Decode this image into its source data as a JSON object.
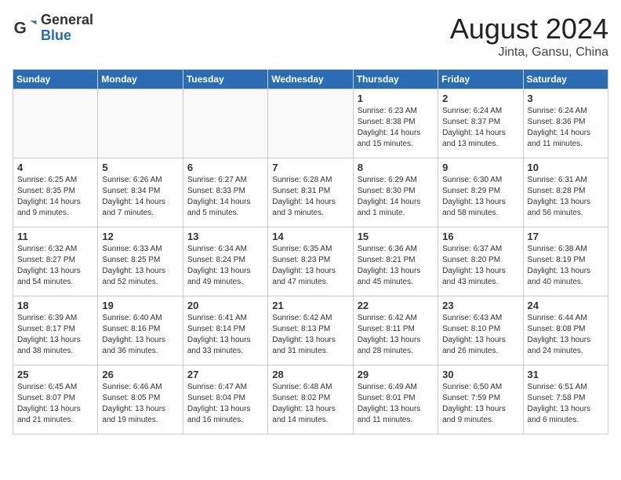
{
  "header": {
    "logo_general": "General",
    "logo_blue": "Blue",
    "month_title": "August 2024",
    "location": "Jinta, Gansu, China"
  },
  "weekdays": [
    "Sunday",
    "Monday",
    "Tuesday",
    "Wednesday",
    "Thursday",
    "Friday",
    "Saturday"
  ],
  "weeks": [
    [
      {
        "day": "",
        "info": ""
      },
      {
        "day": "",
        "info": ""
      },
      {
        "day": "",
        "info": ""
      },
      {
        "day": "",
        "info": ""
      },
      {
        "day": "1",
        "info": "Sunrise: 6:23 AM\nSunset: 8:38 PM\nDaylight: 14 hours\nand 15 minutes."
      },
      {
        "day": "2",
        "info": "Sunrise: 6:24 AM\nSunset: 8:37 PM\nDaylight: 14 hours\nand 13 minutes."
      },
      {
        "day": "3",
        "info": "Sunrise: 6:24 AM\nSunset: 8:36 PM\nDaylight: 14 hours\nand 11 minutes."
      }
    ],
    [
      {
        "day": "4",
        "info": "Sunrise: 6:25 AM\nSunset: 8:35 PM\nDaylight: 14 hours\nand 9 minutes."
      },
      {
        "day": "5",
        "info": "Sunrise: 6:26 AM\nSunset: 8:34 PM\nDaylight: 14 hours\nand 7 minutes."
      },
      {
        "day": "6",
        "info": "Sunrise: 6:27 AM\nSunset: 8:33 PM\nDaylight: 14 hours\nand 5 minutes."
      },
      {
        "day": "7",
        "info": "Sunrise: 6:28 AM\nSunset: 8:31 PM\nDaylight: 14 hours\nand 3 minutes."
      },
      {
        "day": "8",
        "info": "Sunrise: 6:29 AM\nSunset: 8:30 PM\nDaylight: 14 hours\nand 1 minute."
      },
      {
        "day": "9",
        "info": "Sunrise: 6:30 AM\nSunset: 8:29 PM\nDaylight: 13 hours\nand 58 minutes."
      },
      {
        "day": "10",
        "info": "Sunrise: 6:31 AM\nSunset: 8:28 PM\nDaylight: 13 hours\nand 56 minutes."
      }
    ],
    [
      {
        "day": "11",
        "info": "Sunrise: 6:32 AM\nSunset: 8:27 PM\nDaylight: 13 hours\nand 54 minutes."
      },
      {
        "day": "12",
        "info": "Sunrise: 6:33 AM\nSunset: 8:25 PM\nDaylight: 13 hours\nand 52 minutes."
      },
      {
        "day": "13",
        "info": "Sunrise: 6:34 AM\nSunset: 8:24 PM\nDaylight: 13 hours\nand 49 minutes."
      },
      {
        "day": "14",
        "info": "Sunrise: 6:35 AM\nSunset: 8:23 PM\nDaylight: 13 hours\nand 47 minutes."
      },
      {
        "day": "15",
        "info": "Sunrise: 6:36 AM\nSunset: 8:21 PM\nDaylight: 13 hours\nand 45 minutes."
      },
      {
        "day": "16",
        "info": "Sunrise: 6:37 AM\nSunset: 8:20 PM\nDaylight: 13 hours\nand 43 minutes."
      },
      {
        "day": "17",
        "info": "Sunrise: 6:38 AM\nSunset: 8:19 PM\nDaylight: 13 hours\nand 40 minutes."
      }
    ],
    [
      {
        "day": "18",
        "info": "Sunrise: 6:39 AM\nSunset: 8:17 PM\nDaylight: 13 hours\nand 38 minutes."
      },
      {
        "day": "19",
        "info": "Sunrise: 6:40 AM\nSunset: 8:16 PM\nDaylight: 13 hours\nand 36 minutes."
      },
      {
        "day": "20",
        "info": "Sunrise: 6:41 AM\nSunset: 8:14 PM\nDaylight: 13 hours\nand 33 minutes."
      },
      {
        "day": "21",
        "info": "Sunrise: 6:42 AM\nSunset: 8:13 PM\nDaylight: 13 hours\nand 31 minutes."
      },
      {
        "day": "22",
        "info": "Sunrise: 6:42 AM\nSunset: 8:11 PM\nDaylight: 13 hours\nand 28 minutes."
      },
      {
        "day": "23",
        "info": "Sunrise: 6:43 AM\nSunset: 8:10 PM\nDaylight: 13 hours\nand 26 minutes."
      },
      {
        "day": "24",
        "info": "Sunrise: 6:44 AM\nSunset: 8:08 PM\nDaylight: 13 hours\nand 24 minutes."
      }
    ],
    [
      {
        "day": "25",
        "info": "Sunrise: 6:45 AM\nSunset: 8:07 PM\nDaylight: 13 hours\nand 21 minutes."
      },
      {
        "day": "26",
        "info": "Sunrise: 6:46 AM\nSunset: 8:05 PM\nDaylight: 13 hours\nand 19 minutes."
      },
      {
        "day": "27",
        "info": "Sunrise: 6:47 AM\nSunset: 8:04 PM\nDaylight: 13 hours\nand 16 minutes."
      },
      {
        "day": "28",
        "info": "Sunrise: 6:48 AM\nSunset: 8:02 PM\nDaylight: 13 hours\nand 14 minutes."
      },
      {
        "day": "29",
        "info": "Sunrise: 6:49 AM\nSunset: 8:01 PM\nDaylight: 13 hours\nand 11 minutes."
      },
      {
        "day": "30",
        "info": "Sunrise: 6:50 AM\nSunset: 7:59 PM\nDaylight: 13 hours\nand 9 minutes."
      },
      {
        "day": "31",
        "info": "Sunrise: 6:51 AM\nSunset: 7:58 PM\nDaylight: 13 hours\nand 6 minutes."
      }
    ]
  ]
}
